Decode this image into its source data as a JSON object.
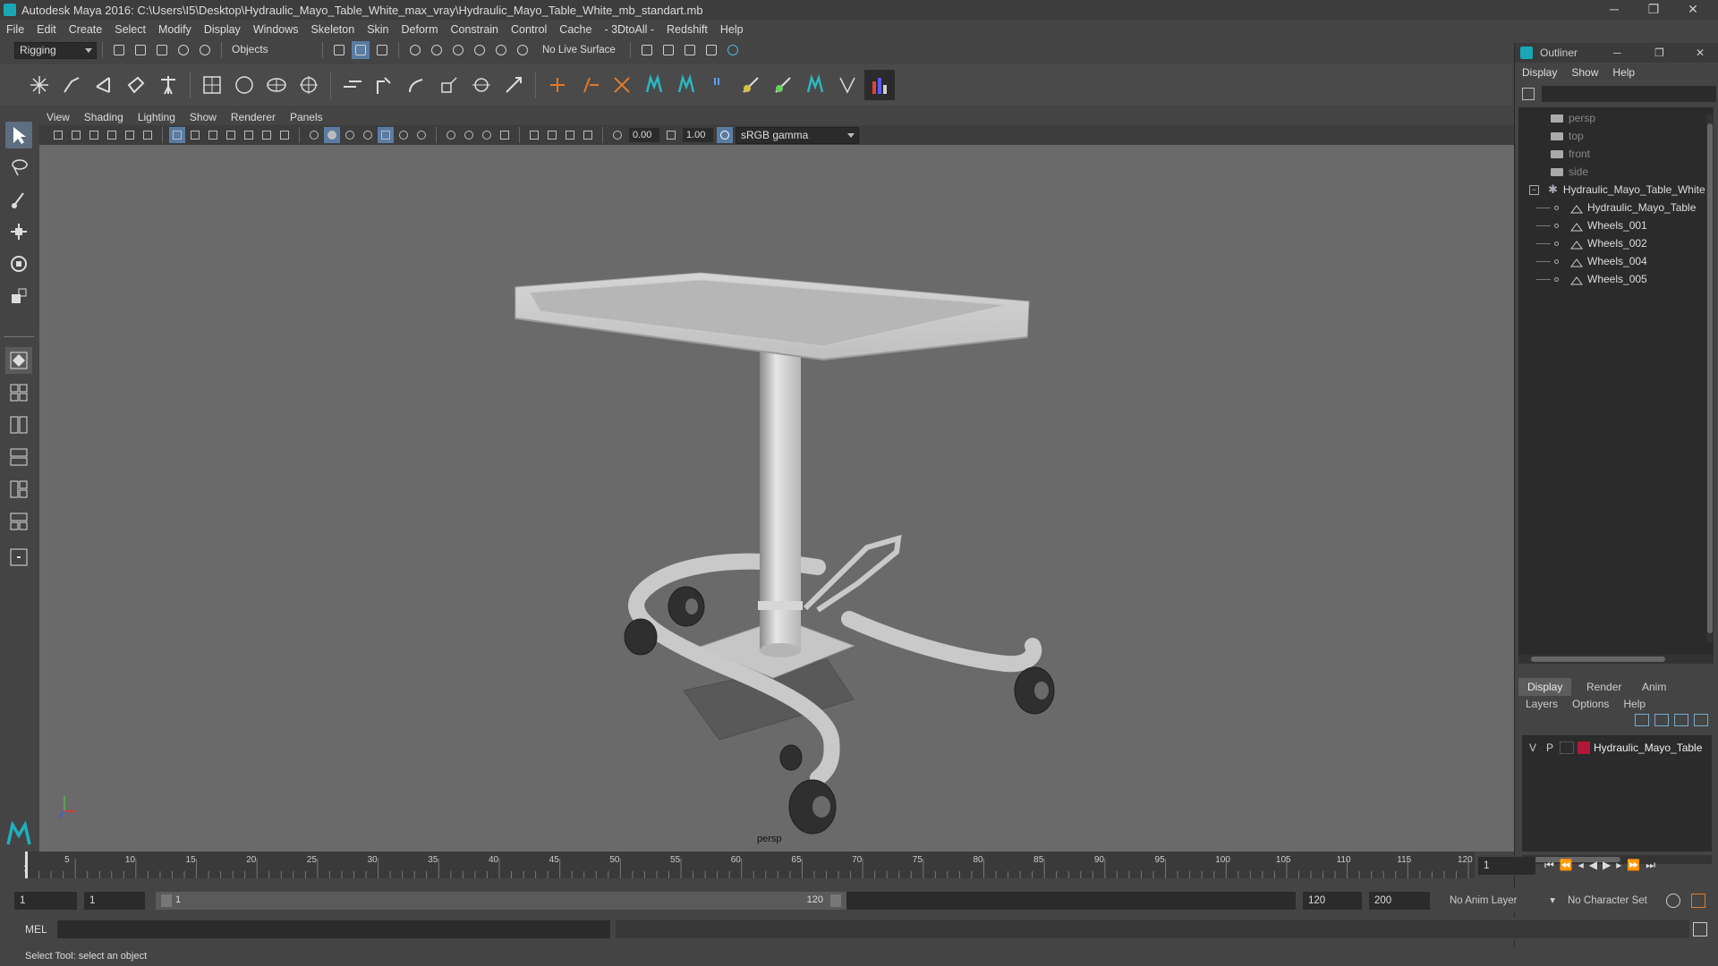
{
  "window": {
    "title": "Autodesk Maya 2016: C:\\Users\\I5\\Desktop\\Hydraulic_Mayo_Table_White_max_vray\\Hydraulic_Mayo_Table_White_mb_standart.mb",
    "min_glyph": "─",
    "restore_glyph": "❐",
    "close_glyph": "✕"
  },
  "menubar": [
    "File",
    "Edit",
    "Create",
    "Select",
    "Modify",
    "Display",
    "Windows",
    "Skeleton",
    "Skin",
    "Deform",
    "Constrain",
    "Control",
    "Cache",
    "- 3DtoAll -",
    "Redshift",
    "Help"
  ],
  "toolbar": {
    "mode": "Rigging",
    "objects": "Objects",
    "live_surface": "No Live Surface"
  },
  "viewport": {
    "menu": [
      "View",
      "Shading",
      "Lighting",
      "Show",
      "Renderer",
      "Panels"
    ],
    "exposure": "0.00",
    "gamma": "1.00",
    "color_space": "sRGB gamma",
    "camera_label": "persp"
  },
  "outliner": {
    "title": "Outliner",
    "menu": [
      "Display",
      "Show",
      "Help"
    ],
    "cameras": [
      "persp",
      "top",
      "front",
      "side"
    ],
    "group": "Hydraulic_Mayo_Table_White",
    "children": [
      "Hydraulic_Mayo_Table",
      "Wheels_001",
      "Wheels_002",
      "Wheels_004",
      "Wheels_005"
    ]
  },
  "layers": {
    "tabs": [
      "Display",
      "Render",
      "Anim"
    ],
    "menu": [
      "Layers",
      "Options",
      "Help"
    ],
    "layer": {
      "v": "V",
      "p": "P",
      "name": "Hydraulic_Mayo_Table",
      "color": "#b0173a"
    }
  },
  "timeline": {
    "ticks": [
      "5",
      "10",
      "15",
      "20",
      "25",
      "30",
      "35",
      "40",
      "45",
      "50",
      "55",
      "60",
      "65",
      "70",
      "75",
      "80",
      "85",
      "90",
      "95",
      "100",
      "105",
      "110",
      "115",
      "120"
    ],
    "start_tick": "1",
    "current_frame": "1"
  },
  "range": {
    "start": "1",
    "playback_start": "1",
    "slider_start": "1",
    "slider_end": "120",
    "playback_end": "120",
    "end": "200",
    "anim_layer": "No Anim Layer",
    "character_set": "No Character Set"
  },
  "command": {
    "lang": "MEL"
  },
  "status": {
    "text": "Select Tool: select an object"
  }
}
